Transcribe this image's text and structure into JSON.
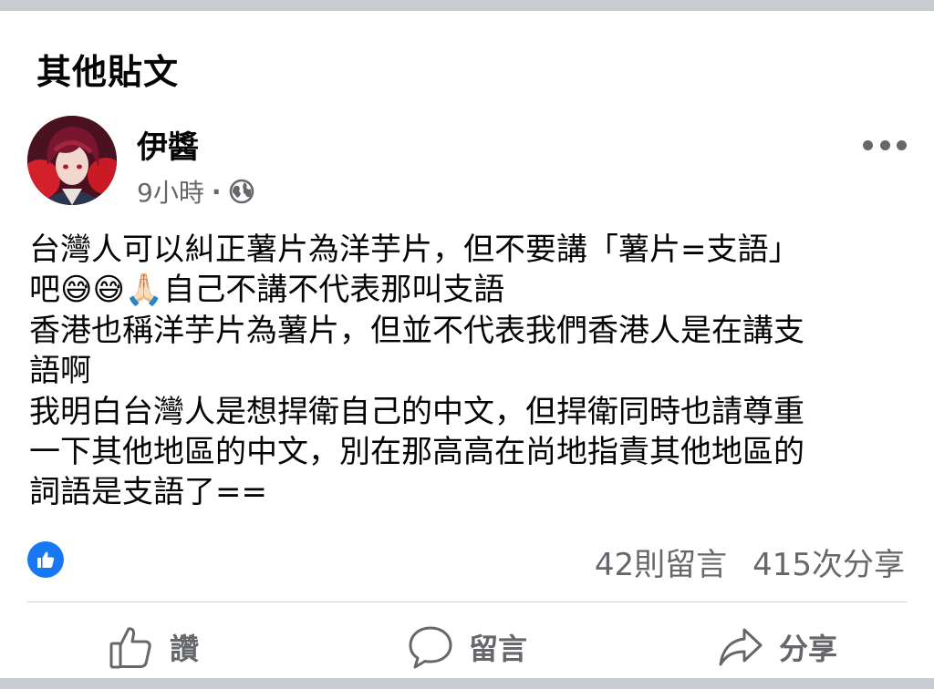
{
  "section": {
    "title": "其他貼文"
  },
  "post": {
    "author": "伊醬",
    "time": "9小時",
    "separator": "·",
    "privacy_icon": "globe-icon",
    "body": "台灣人可以糾正薯片為洋芋片，但不要講「薯片=支語」\n吧😅😅🙏🏻自己不講不代表那叫支語\n香港也稱洋芋片為薯片，但並不代表我們香港人是在講支\n語啊\n我明白台灣人是想捍衛自己的中文，但捍衛同時也請尊重\n一下其他地區的中文，別在那高高在尚地指責其他地區的\n詞語是支語了==",
    "comments": "42則留言",
    "shares": "415次分享"
  },
  "actions": {
    "like": "讚",
    "comment": "留言",
    "share": "分享"
  },
  "colors": {
    "accent": "#1877f2",
    "secondary_text": "#65676b",
    "divider": "#ced0d4",
    "page_bg": "#c9ccd1"
  }
}
